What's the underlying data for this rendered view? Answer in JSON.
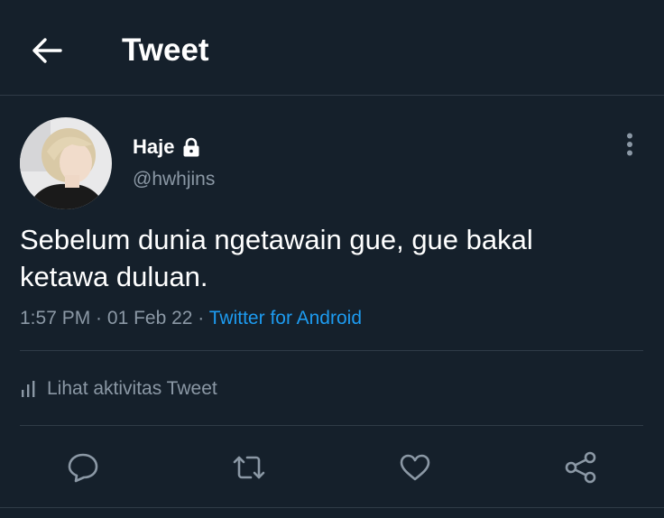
{
  "header": {
    "title": "Tweet"
  },
  "author": {
    "display_name": "Haje",
    "handle": "@hwhjins",
    "protected": true
  },
  "tweet": {
    "text_line1": "Sebelum dunia ngetawain gue, gue bakal",
    "text_line2": "ketawa duluan.",
    "time": "1:57 PM",
    "separator1": " · ",
    "date": "01 Feb 22",
    "separator2": " · ",
    "source": "Twitter for Android"
  },
  "activity": {
    "label": "Lihat aktivitas Tweet"
  },
  "actions": [
    "reply-icon",
    "retweet-icon",
    "like-icon",
    "share-icon"
  ],
  "colors": {
    "background": "#15202b",
    "text": "#ffffff",
    "secondary_text": "#8b98a5",
    "link": "#1d9bf0",
    "divider": "#2f3b47"
  }
}
